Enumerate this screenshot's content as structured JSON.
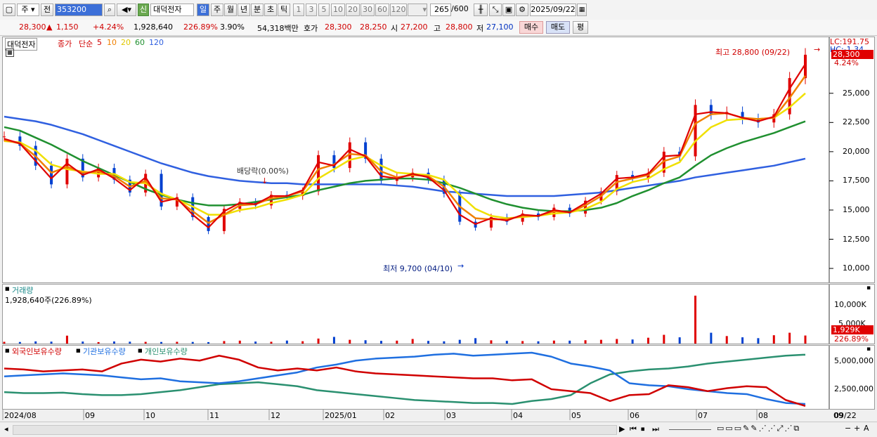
{
  "toolbar": {
    "market": "주",
    "prev_label": "전",
    "code": "353200",
    "sin": "신",
    "name": "대덕전자",
    "periods": [
      "일",
      "주",
      "월",
      "년",
      "분",
      "초",
      "틱"
    ],
    "minutes": [
      "1",
      "3",
      "5",
      "10",
      "20",
      "30",
      "60",
      "120"
    ],
    "count": "265",
    "count_max": "/600",
    "date": "2025/09/22"
  },
  "quote": {
    "price": "28,300",
    "up_icon": "up-triangle-icon",
    "change": "1,150",
    "change_pct": "+4.24%",
    "volume": "1,928,640",
    "volume_pct": "226.89%",
    "turnover": "3.90%",
    "amount": "54,318백만",
    "ask_label": "호가",
    "ask": "28,300",
    "bid": "28,250",
    "open_label": "시",
    "open": "27,200",
    "high_label": "고",
    "high": "28,800",
    "low_label": "저",
    "low": "27,100",
    "buy": "매수",
    "sell": "매도",
    "eval": "평"
  },
  "legend": {
    "name": "대덕전자",
    "close": "종가",
    "ma_type": "단순",
    "ma": [
      "5",
      "10",
      "20",
      "60",
      "120"
    ]
  },
  "colors": {
    "up": "#e00000",
    "down": "#0040d0",
    "ma5": "#e00000",
    "ma10": "#f08000",
    "ma20": "#f0e000",
    "ma60": "#209030",
    "ma120": "#3060e0"
  },
  "annotations": {
    "high": "최고 28,800 (09/22)",
    "low": "최저 9,700 (04/10)",
    "dividend": "배당락(0.00%)",
    "lc": "LC:191.75",
    "hc": "HC:-1.34",
    "last": "28,300",
    "last_pct": "4.24%"
  },
  "volume_panel": {
    "title": "거래량",
    "value": "1,928,640주(226.89%)",
    "ticks": [
      "10,000K",
      "5,000K"
    ],
    "last": "1,929K",
    "last_pct": "226.89%"
  },
  "holding_panel": {
    "foreign": "외국인보유수량",
    "inst": "기관보유수량",
    "indiv": "개인보유수량",
    "ticks": [
      "5,000,000",
      "2,500,000"
    ]
  },
  "chart_data": {
    "type": "line",
    "title": "대덕전자",
    "x": [
      "2024/08",
      "09",
      "10",
      "11",
      "12",
      "2025/01",
      "02",
      "03",
      "04",
      "05",
      "06",
      "07",
      "08",
      "09",
      "09/22"
    ],
    "ylim": [
      8800,
      29800
    ],
    "yticks": [
      "25,000",
      "22,500",
      "20,000",
      "17,500",
      "15,000",
      "12,500",
      "10,000"
    ],
    "series": [
      {
        "name": "종가",
        "values": [
          21300,
          20500,
          18800,
          17200,
          19400,
          17800,
          18600,
          17600,
          16500,
          18100,
          15300,
          16100,
          14400,
          13200,
          15100,
          15700,
          15400,
          16300,
          16200,
          16600,
          19700,
          18600,
          20800,
          19400,
          17500,
          17800,
          18200,
          17600,
          16400,
          14000,
          13500,
          14400,
          14000,
          14700,
          14400,
          15200,
          14700,
          15800,
          16600,
          18000,
          17700,
          18200,
          20000,
          19600,
          24000,
          23200,
          23400,
          22800,
          22500,
          23200,
          26300,
          28300
        ]
      },
      {
        "name": "5",
        "values": [
          21100,
          20700,
          19200,
          17700,
          19000,
          18000,
          18500,
          17700,
          16700,
          17800,
          15700,
          16000,
          14600,
          13500,
          14900,
          15600,
          15500,
          16200,
          16200,
          16700,
          19100,
          18800,
          20200,
          19600,
          17900,
          17700,
          18100,
          17800,
          16700,
          14600,
          13800,
          14300,
          14100,
          14600,
          14500,
          15000,
          14800,
          15600,
          16400,
          17700,
          17800,
          18100,
          19600,
          19700,
          23200,
          23400,
          23300,
          22900,
          22600,
          23000,
          25400,
          27500
        ]
      },
      {
        "name": "10",
        "values": [
          21000,
          20700,
          19600,
          18200,
          18700,
          18200,
          18300,
          17900,
          17000,
          17500,
          16000,
          15900,
          14900,
          13900,
          14600,
          15400,
          15500,
          16000,
          16200,
          16600,
          18500,
          18900,
          19800,
          19700,
          18300,
          17800,
          18000,
          17900,
          17000,
          15300,
          14300,
          14200,
          14200,
          14500,
          14500,
          14900,
          14800,
          15400,
          16200,
          17400,
          17700,
          18000,
          19200,
          19600,
          22400,
          23200,
          23300,
          22900,
          22800,
          22900,
          24600,
          26500
        ]
      },
      {
        "name": "20",
        "values": [
          20900,
          20800,
          20100,
          18900,
          18500,
          18300,
          18100,
          18100,
          17400,
          17300,
          16400,
          15900,
          15300,
          14600,
          14600,
          15000,
          15200,
          15600,
          15900,
          16300,
          17700,
          18500,
          19300,
          19600,
          18800,
          18200,
          18100,
          18000,
          17600,
          16300,
          15100,
          14500,
          14300,
          14400,
          14500,
          14700,
          14800,
          15100,
          15700,
          16800,
          17400,
          17700,
          18500,
          19100,
          20900,
          22100,
          22700,
          22800,
          22800,
          22900,
          23800,
          25000
        ]
      },
      {
        "name": "60",
        "values": [
          22100,
          21800,
          21200,
          20600,
          19900,
          19200,
          18600,
          18000,
          17400,
          16800,
          16300,
          15900,
          15600,
          15400,
          15400,
          15500,
          15700,
          15900,
          16100,
          16300,
          16700,
          17000,
          17300,
          17500,
          17600,
          17700,
          17700,
          17600,
          17300,
          16900,
          16400,
          15900,
          15500,
          15200,
          15000,
          14900,
          14900,
          15000,
          15200,
          15600,
          16200,
          16700,
          17300,
          17800,
          18800,
          19700,
          20300,
          20800,
          21200,
          21600,
          22100,
          22600
        ]
      },
      {
        "name": "120",
        "values": [
          23000,
          22800,
          22600,
          22300,
          21900,
          21500,
          21000,
          20500,
          20000,
          19500,
          19000,
          18600,
          18200,
          17900,
          17700,
          17500,
          17400,
          17300,
          17300,
          17200,
          17200,
          17200,
          17200,
          17200,
          17200,
          17100,
          17000,
          16800,
          16600,
          16500,
          16400,
          16300,
          16200,
          16200,
          16200,
          16200,
          16300,
          16400,
          16500,
          16700,
          16900,
          17100,
          17300,
          17500,
          17800,
          18000,
          18200,
          18400,
          18600,
          18800,
          19100,
          19400
        ]
      }
    ],
    "volume": {
      "ylim": [
        0,
        14000
      ],
      "values": [
        420,
        380,
        520,
        460,
        1900,
        480,
        350,
        500,
        450,
        410,
        380,
        420,
        390,
        350,
        600,
        700,
        480,
        430,
        720,
        560,
        1200,
        1600,
        900,
        800,
        650,
        700,
        1100,
        640,
        540,
        900,
        1300,
        780,
        650,
        600,
        540,
        720,
        700,
        800,
        900,
        1100,
        980,
        1400,
        2100,
        1500,
        11500,
        2600,
        1800,
        1500,
        1300,
        2000,
        2600,
        1929
      ]
    },
    "holding": {
      "ylim": [
        0,
        6200000
      ],
      "foreign": [
        4100000,
        4000000,
        3800000,
        3900000,
        4000000,
        3800000,
        4600000,
        5000000,
        4800000,
        5100000,
        4900000,
        5400000,
        5000000,
        4200000,
        3900000,
        4100000,
        3900000,
        4200000,
        3800000,
        3600000,
        3500000,
        3400000,
        3300000,
        3200000,
        3100000,
        3100000,
        2900000,
        3000000,
        2000000,
        1800000,
        1600000,
        800000,
        1400000,
        1500000,
        2400000,
        2200000,
        1800000,
        2100000,
        2300000,
        2200000,
        900000,
        300000
      ],
      "inst": [
        3300000,
        3400000,
        3500000,
        3600000,
        3500000,
        3400000,
        3200000,
        3000000,
        3100000,
        2800000,
        2700000,
        2600000,
        2800000,
        3100000,
        3400000,
        3700000,
        4200000,
        4500000,
        4900000,
        5100000,
        5200000,
        5300000,
        5500000,
        5600000,
        5400000,
        5500000,
        5600000,
        5700000,
        5300000,
        4600000,
        4300000,
        3900000,
        2600000,
        2400000,
        2300000,
        2000000,
        1800000,
        1600000,
        1500000,
        1000000,
        600000,
        500000
      ],
      "indiv": [
        1700000,
        1600000,
        1600000,
        1650000,
        1500000,
        1400000,
        1400000,
        1500000,
        1700000,
        1900000,
        2200000,
        2500000,
        2600000,
        2700000,
        2500000,
        2300000,
        1900000,
        1700000,
        1500000,
        1300000,
        1100000,
        900000,
        800000,
        700000,
        600000,
        600000,
        500000,
        800000,
        1000000,
        1400000,
        2600000,
        3500000,
        3800000,
        4000000,
        4100000,
        4300000,
        4600000,
        4800000,
        5000000,
        5200000,
        5400000,
        5500000
      ]
    }
  },
  "status": {
    "flags": [
      "▶",
      "⏮",
      "⏹",
      "⏭"
    ],
    "zoom_minus": "−",
    "zoom_plus": "+",
    "auto": "A"
  }
}
